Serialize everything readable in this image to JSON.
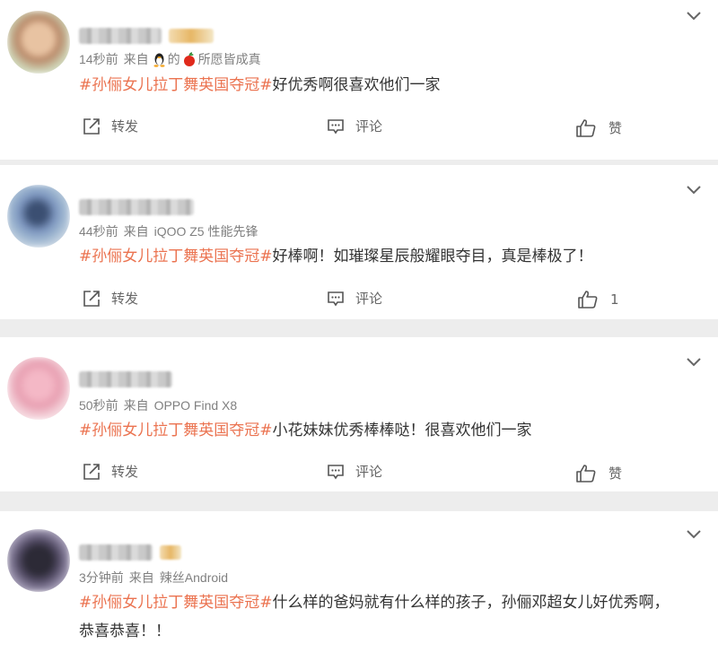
{
  "posts": [
    {
      "time": "14秒前",
      "from_prefix": "来自",
      "source_middle": "的",
      "source": "所愿皆成真",
      "hashtag": "#孙俪女儿拉丁舞英国夺冠#",
      "text": "好优秀啊很喜欢他们一家",
      "repost_label": "转发",
      "comment_label": "评论",
      "like_label": "赞"
    },
    {
      "time": "44秒前",
      "from_prefix": "来自",
      "source": "iQOO Z5 性能先锋",
      "hashtag": "#孙俪女儿拉丁舞英国夺冠#",
      "text": "好棒啊！如璀璨星辰般耀眼夺目，真是棒极了！",
      "repost_label": "转发",
      "comment_label": "评论",
      "like_label": "1"
    },
    {
      "time": "50秒前",
      "from_prefix": "来自",
      "source": "OPPO Find X8",
      "hashtag": "#孙俪女儿拉丁舞英国夺冠#",
      "text": "小花妹妹优秀棒棒哒！很喜欢他们一家",
      "repost_label": "转发",
      "comment_label": "评论",
      "like_label": "赞"
    },
    {
      "time": "3分钟前",
      "from_prefix": "来自",
      "source": "辣丝Android",
      "hashtag": "#孙俪女儿拉丁舞英国夺冠#",
      "text": "什么样的爸妈就有什么样的孩子，孙俪邓超女儿好优秀啊，",
      "text_line2": "恭喜恭喜！！"
    }
  ],
  "icons": {
    "repost": "repost-icon",
    "comment": "comment-icon",
    "like": "thumbs-up-icon",
    "menu": "chevron-down-icon"
  },
  "colors": {
    "hashtag": "#eb7350",
    "meta": "#808080",
    "separator": "#ededed"
  }
}
